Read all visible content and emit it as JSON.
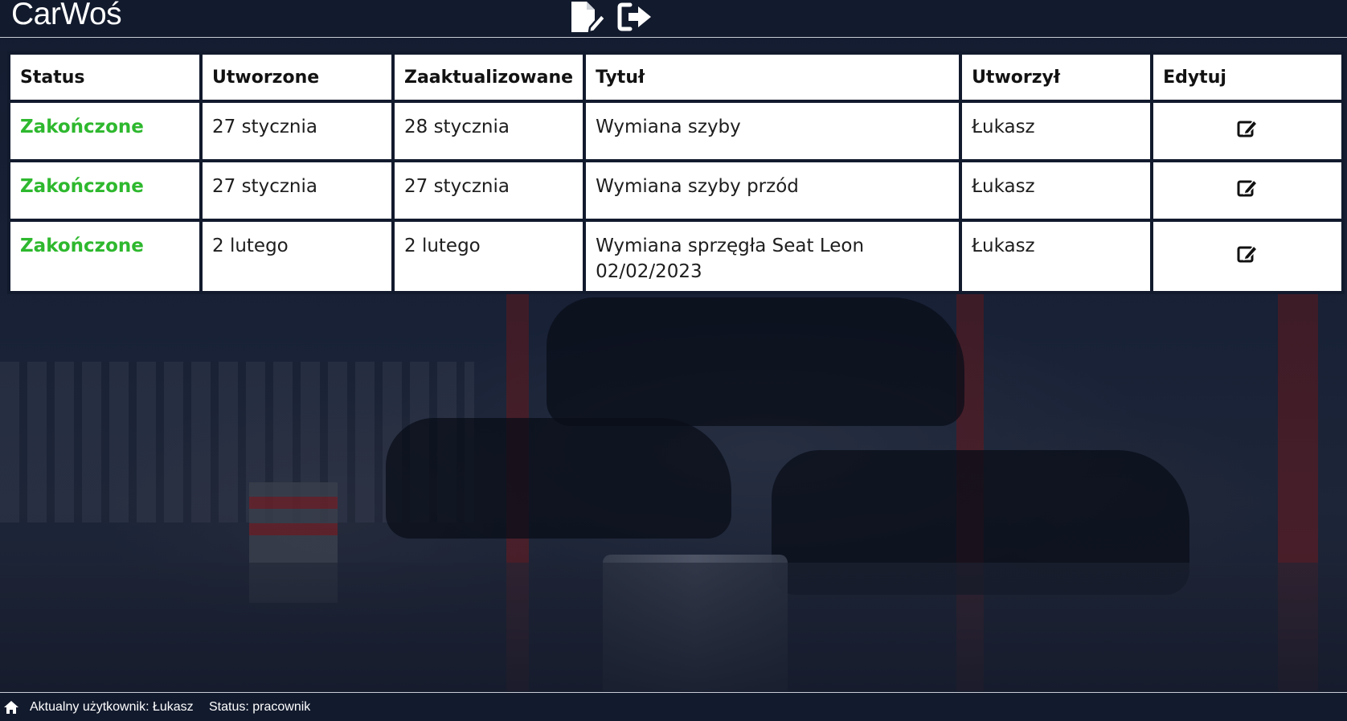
{
  "app": {
    "title": "CarWoś"
  },
  "header": {
    "icons": [
      "file-edit-icon",
      "sign-out-icon"
    ]
  },
  "table": {
    "headers": [
      "Status",
      "Utworzone",
      "Zaaktualizowane",
      "Tytuł",
      "Utworzył",
      "Edytuj"
    ],
    "rows": [
      {
        "status": "Zakończone",
        "created": "27 stycznia",
        "updated": "28 stycznia",
        "title": "Wymiana szyby",
        "author": "Łukasz",
        "edit_icon": "edit-icon"
      },
      {
        "status": "Zakończone",
        "created": "27 stycznia",
        "updated": "27 stycznia",
        "title": "Wymiana szyby przód",
        "author": "Łukasz",
        "edit_icon": "edit-icon"
      },
      {
        "status": "Zakończone",
        "created": "2 lutego",
        "updated": "2 lutego",
        "title": "Wymiana sprzęgła Seat Leon 02/02/2023",
        "author": "Łukasz",
        "edit_icon": "edit-icon"
      }
    ]
  },
  "footer": {
    "home_icon": "home-icon",
    "current_user": "Aktualny użytkownik: Łukasz",
    "status": "Status: pracownik"
  },
  "colors": {
    "background": "#121a2d",
    "status_done": "#2eb82e",
    "cell_background": "#ffffff"
  }
}
